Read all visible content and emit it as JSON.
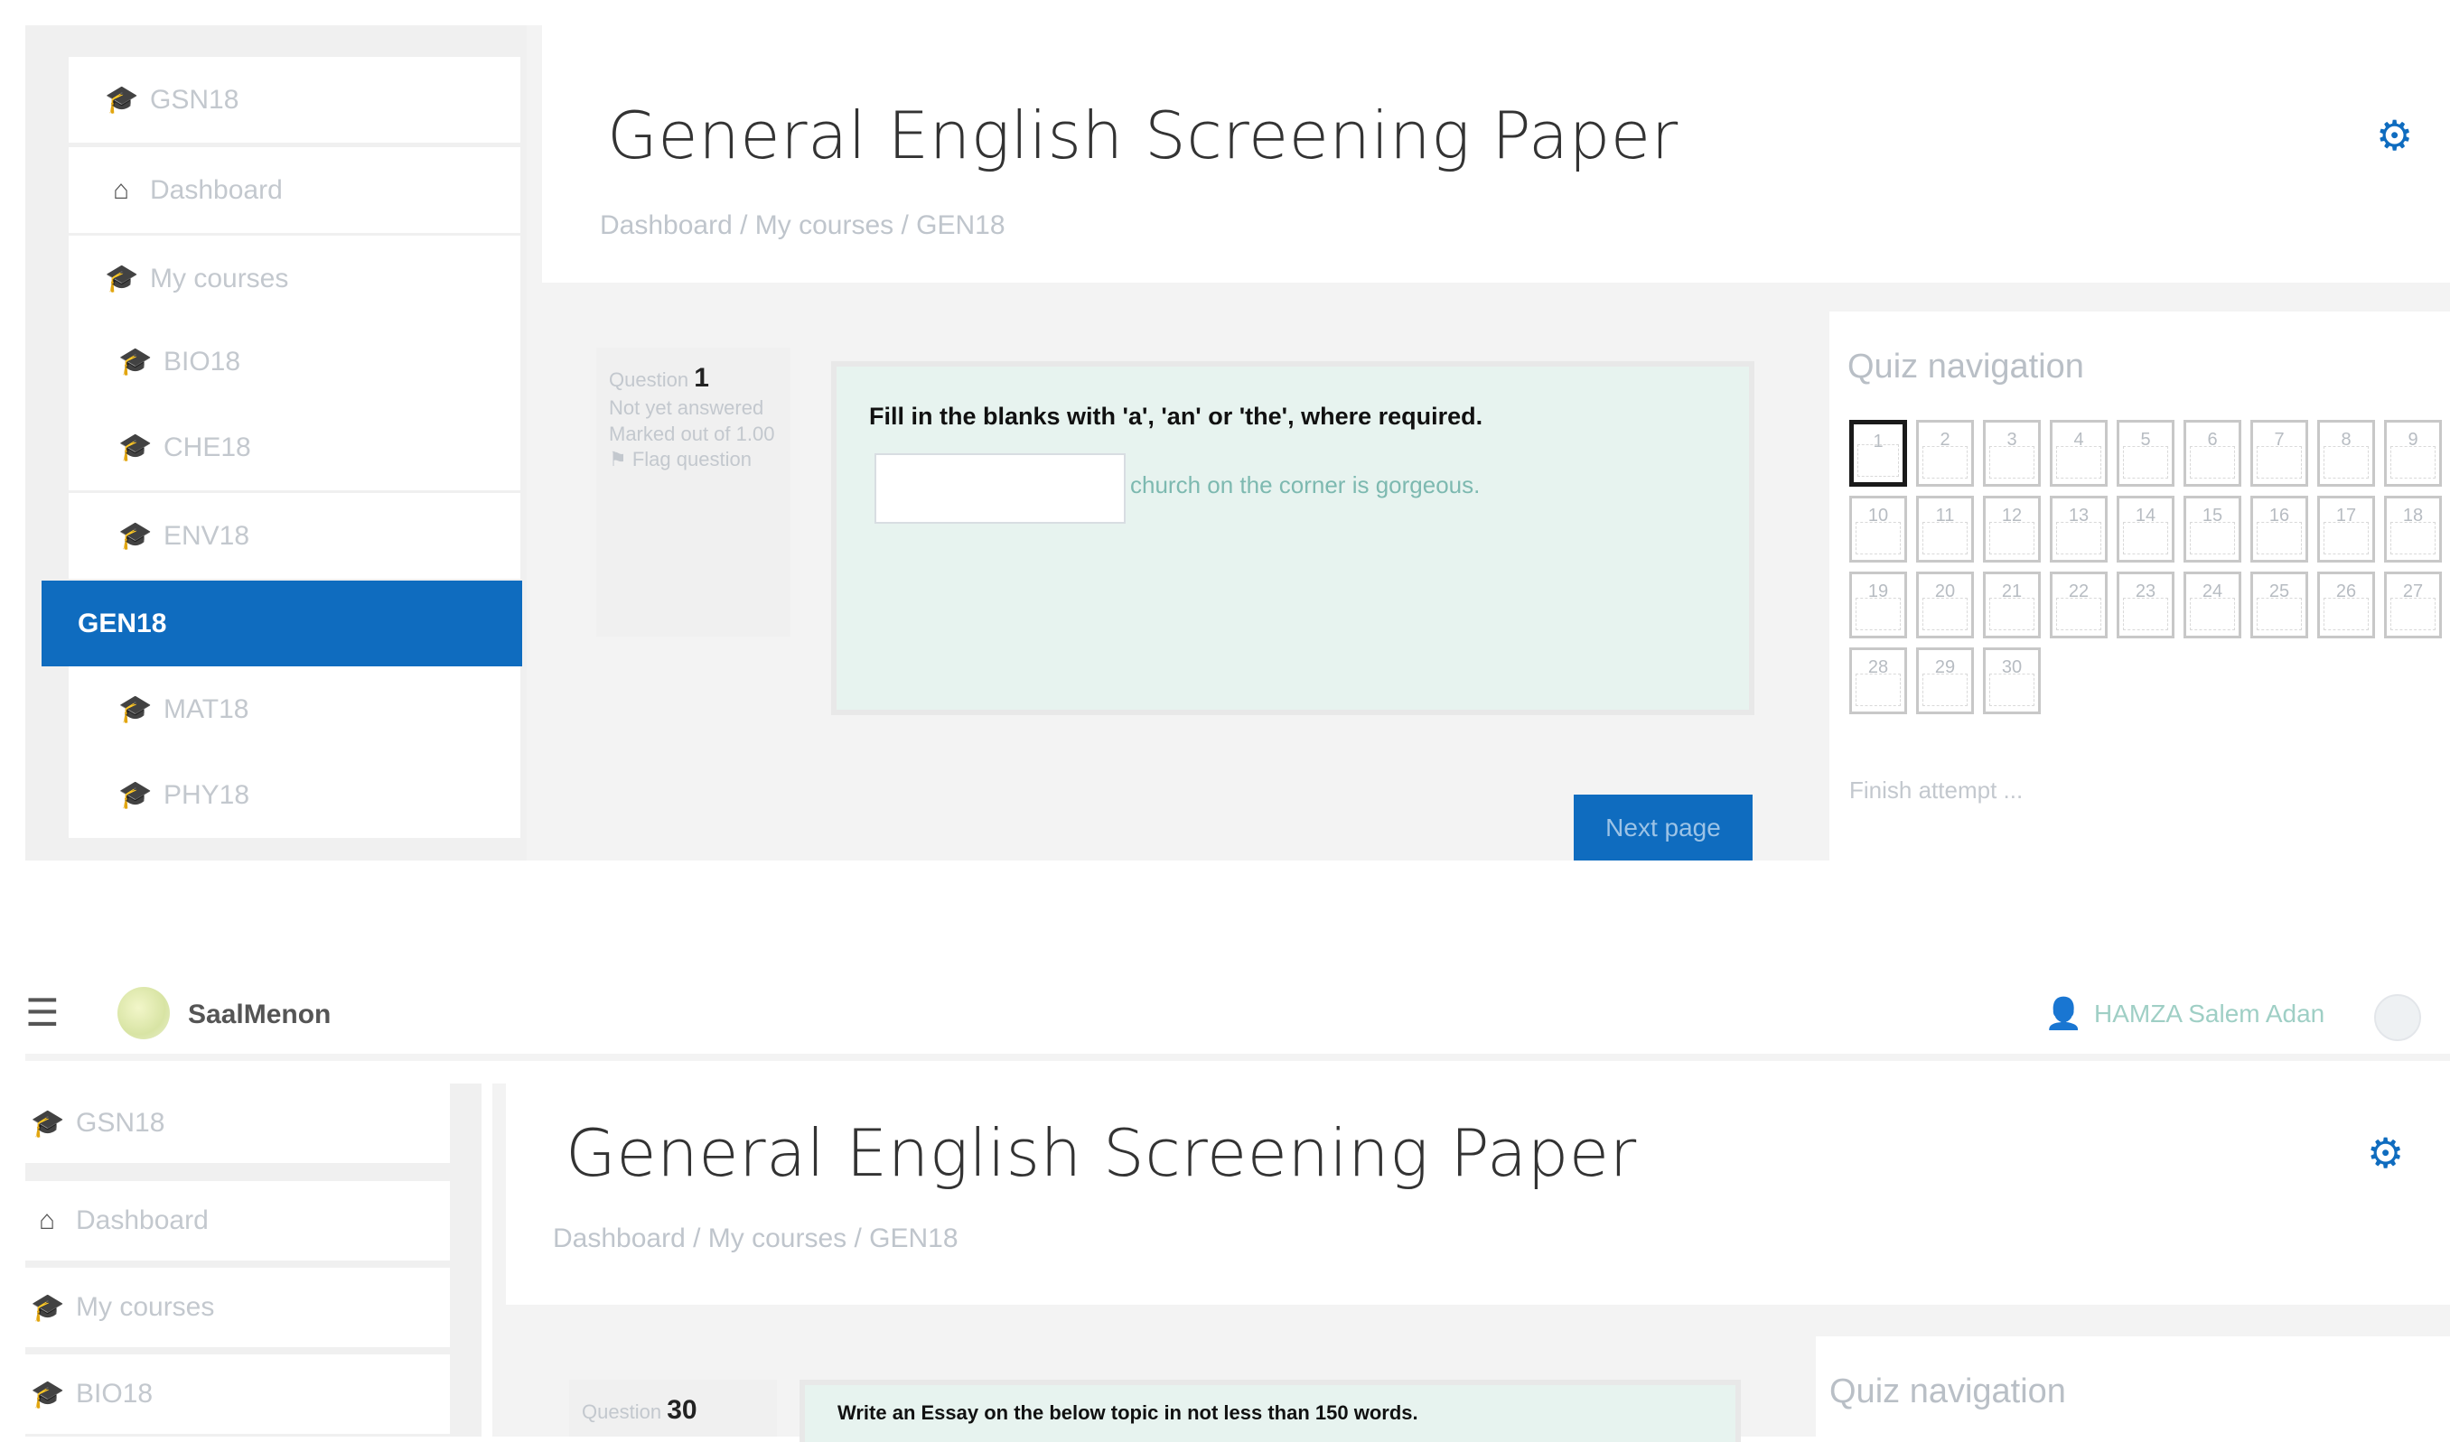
{
  "top": {
    "sidebar": {
      "items": [
        {
          "icon": "graduation-cap-icon",
          "glyph": "🎓",
          "label": "GSN18"
        },
        {
          "icon": "home-icon",
          "glyph": "⌂",
          "label": "Dashboard"
        },
        {
          "icon": "graduation-cap-icon",
          "glyph": "🎓",
          "label": "My courses"
        },
        {
          "icon": "graduation-cap-icon",
          "glyph": "🎓",
          "label": "BIO18"
        },
        {
          "icon": "graduation-cap-icon",
          "glyph": "🎓",
          "label": "CHE18"
        },
        {
          "icon": "graduation-cap-icon",
          "glyph": "🎓",
          "label": "ENV18"
        },
        {
          "icon": "",
          "glyph": "",
          "label": "GEN18"
        },
        {
          "icon": "graduation-cap-icon",
          "glyph": "🎓",
          "label": "MAT18"
        },
        {
          "icon": "graduation-cap-icon",
          "glyph": "🎓",
          "label": "PHY18"
        }
      ]
    },
    "header": {
      "title": "General English Screening Paper",
      "breadcrumb": "Dashboard / My courses / GEN18",
      "gear_glyph": "⚙"
    },
    "question": {
      "number_label": "Question",
      "number": "1",
      "status": "Not yet answered",
      "marks": "Marked out of 1.00",
      "flag": "Flag question",
      "text": "Fill in the blanks with 'a', 'an' or 'the', where required.",
      "input_value": "",
      "hint": "church on the corner is gorgeous.",
      "next_label": "Next page"
    },
    "quiz_nav": {
      "title": "Quiz navigation",
      "buttons": [
        "1",
        "2",
        "3",
        "4",
        "5",
        "6",
        "7",
        "8",
        "9",
        "10",
        "11",
        "12",
        "13",
        "14",
        "15",
        "16",
        "17",
        "18",
        "19",
        "20",
        "21",
        "22",
        "23",
        "24",
        "25",
        "26",
        "27",
        "28",
        "29",
        "30"
      ],
      "finish": "Finish attempt ..."
    }
  },
  "bottom": {
    "navbar": {
      "menu_glyph": "☰",
      "site_name": "SaalMenon",
      "user_glyph": "👤",
      "user_name": "HAMZA Salem Adan"
    },
    "sidebar": {
      "items": [
        {
          "icon": "graduation-cap-icon",
          "glyph": "🎓",
          "label": "GSN18"
        },
        {
          "icon": "home-icon",
          "glyph": "⌂",
          "label": "Dashboard"
        },
        {
          "icon": "graduation-cap-icon",
          "glyph": "🎓",
          "label": "My courses"
        },
        {
          "icon": "graduation-cap-icon",
          "glyph": "🎓",
          "label": "BIO18"
        }
      ]
    },
    "header": {
      "title": "General English Screening Paper",
      "breadcrumb": "Dashboard / My courses / GEN18",
      "gear_glyph": "⚙"
    },
    "question": {
      "number_label": "Question",
      "number": "30",
      "text": "Write an Essay on the below topic in not less than 150 words."
    },
    "quiz_nav": {
      "title": "Quiz navigation"
    }
  }
}
